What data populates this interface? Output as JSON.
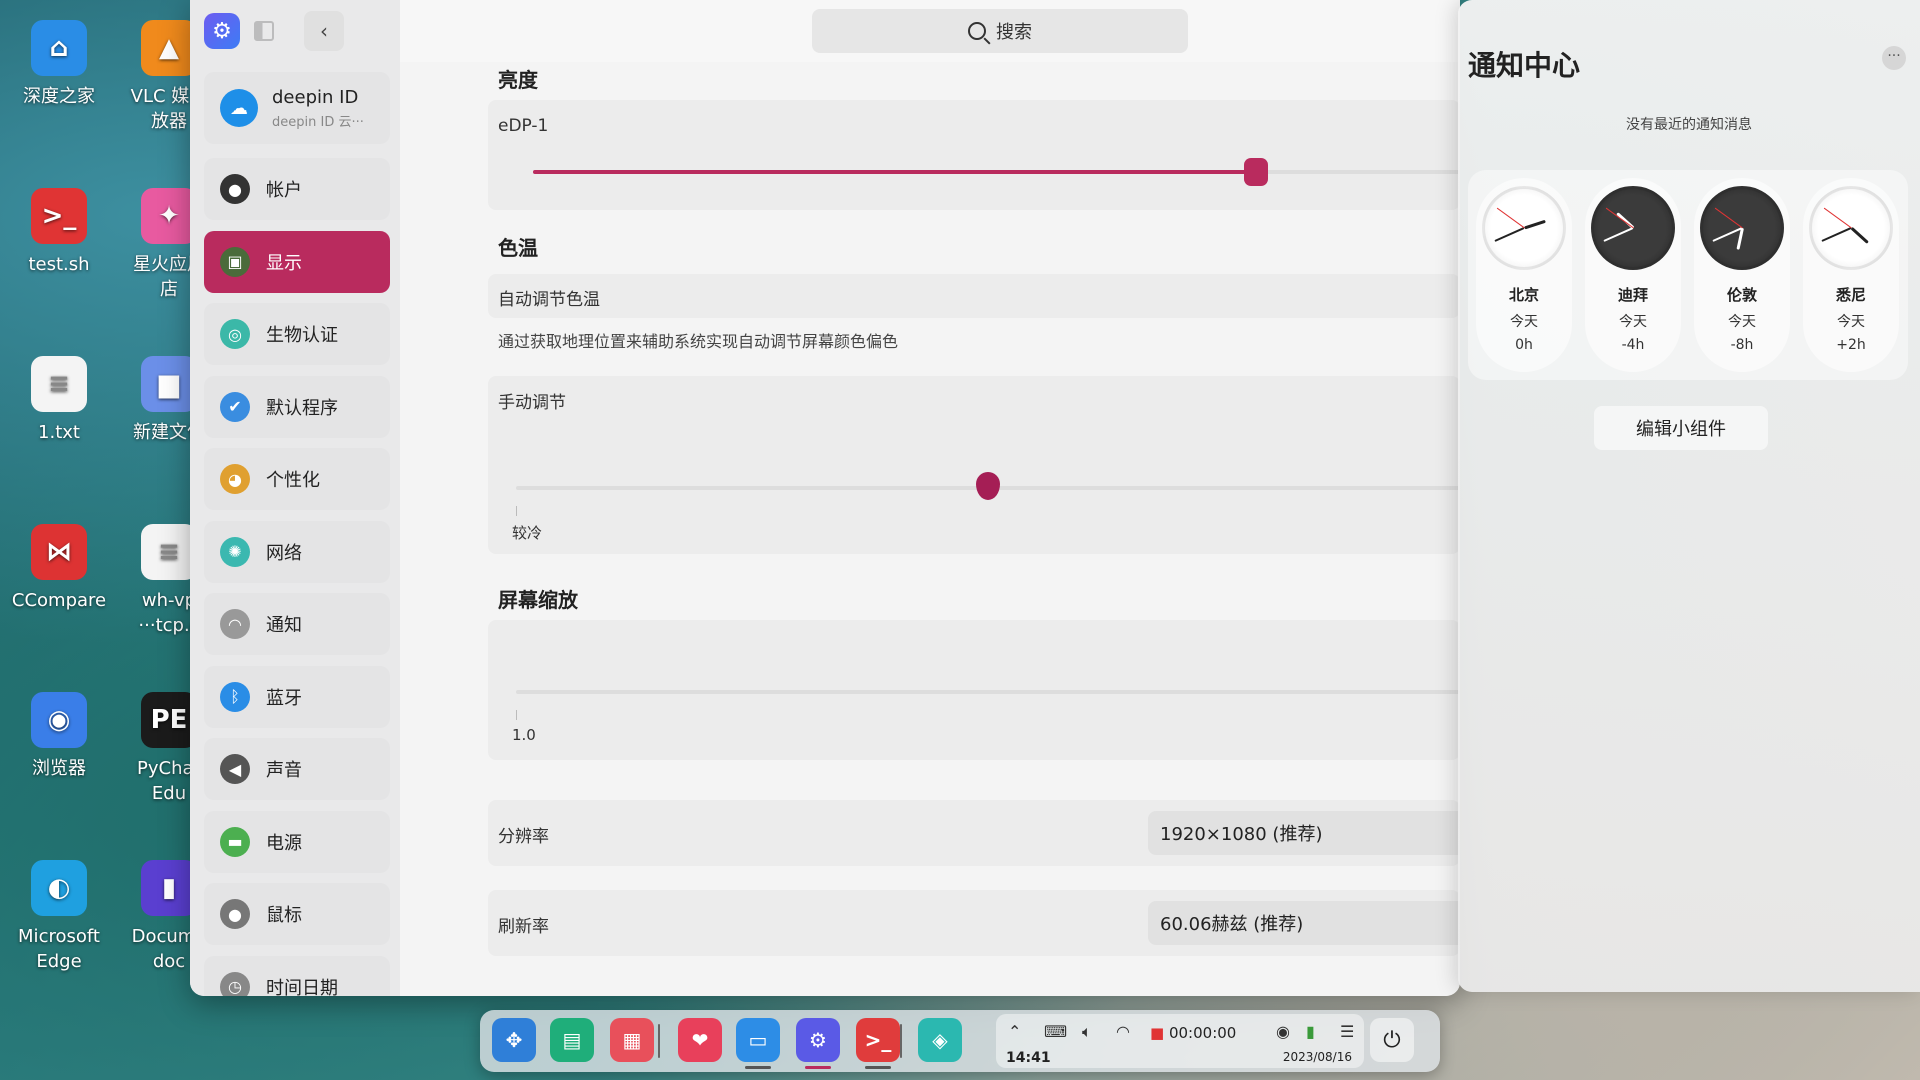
{
  "desktop": {
    "icons": [
      {
        "label": "深度之家",
        "glyph": "⌂",
        "color": "#2a8de6"
      },
      {
        "label": "VLC 媒体\n放器",
        "glyph": "▲",
        "color": "#f08a1c"
      },
      {
        "label": "test.sh",
        "glyph": ">_",
        "color": "#e03434"
      },
      {
        "label": "星火应用\n店",
        "glyph": "✦",
        "color": "#e85aa0"
      },
      {
        "label": "1.txt",
        "glyph": "≡",
        "color": "#f4f4f4"
      },
      {
        "label": "新建文件",
        "glyph": "▆",
        "color": "#6b8fe8"
      },
      {
        "label": "CCompare",
        "glyph": "⋈",
        "color": "#d33"
      },
      {
        "label": "wh-vp\n···tcp.c",
        "glyph": "≡",
        "color": "#f4f4f4"
      },
      {
        "label": "浏览器",
        "glyph": "◉",
        "color": "#3a7ee8"
      },
      {
        "label": "PyChar\nEdu",
        "glyph": "PE",
        "color": "#1b1b1b"
      },
      {
        "label": "Microsoft\nEdge",
        "glyph": "◐",
        "color": "#1fa0e0"
      },
      {
        "label": "Docume\ndoc",
        "glyph": "▮",
        "color": "#5a3fd0"
      }
    ]
  },
  "sidebar": {
    "deepin_id": {
      "name": "deepin ID",
      "sub": "deepin ID 云···"
    },
    "items": [
      {
        "label": "帐户",
        "icon": "user-icon",
        "glyph": "●",
        "color": "#333"
      },
      {
        "label": "显示",
        "icon": "display-icon",
        "glyph": "▣",
        "color": "#4a6b3a"
      },
      {
        "label": "生物认证",
        "icon": "biometric-icon",
        "glyph": "◎",
        "color": "#3bb8a8"
      },
      {
        "label": "默认程序",
        "icon": "default-apps-icon",
        "glyph": "✔",
        "color": "#3a8de0"
      },
      {
        "label": "个性化",
        "icon": "personalization-icon",
        "glyph": "◕",
        "color": "#e0a030"
      },
      {
        "label": "网络",
        "icon": "network-icon",
        "glyph": "✺",
        "color": "#3bb8b0"
      },
      {
        "label": "通知",
        "icon": "bell-icon",
        "glyph": "◠",
        "color": "#999"
      },
      {
        "label": "蓝牙",
        "icon": "bluetooth-icon",
        "glyph": "ᛒ",
        "color": "#2a8de6"
      },
      {
        "label": "声音",
        "icon": "speaker-icon",
        "glyph": "◀",
        "color": "#555"
      },
      {
        "label": "电源",
        "icon": "battery-icon",
        "glyph": "▬",
        "color": "#4caf50"
      },
      {
        "label": "鼠标",
        "icon": "mouse-icon",
        "glyph": "●",
        "color": "#777"
      },
      {
        "label": "时间日期",
        "icon": "clock-icon",
        "glyph": "◷",
        "color": "#888"
      }
    ],
    "active_index": 1
  },
  "search": {
    "placeholder": "搜索"
  },
  "display": {
    "brightness": {
      "title": "亮度",
      "monitor": "eDP-1",
      "value": 0.78
    },
    "color_temp": {
      "title": "色温",
      "auto_label": "自动调节色温",
      "auto_desc": "通过获取地理位置来辅助系统实现自动调节屏幕颜色偏色",
      "manual_label": "手动调节",
      "min_label": "较冷",
      "value": 0.5
    },
    "scaling": {
      "title": "屏幕缩放",
      "min_label": "1.0"
    },
    "resolution": {
      "label": "分辨率",
      "value": "1920×1080 (推荐)"
    },
    "refresh": {
      "label": "刷新率",
      "value": "60.06赫兹 (推荐)"
    }
  },
  "notification_center": {
    "title": "通知中心",
    "more": "···",
    "empty_text": "没有最近的通知消息",
    "clocks": [
      {
        "city": "北京",
        "day": "今天",
        "offset": "0h",
        "theme": "light",
        "hour_deg": 72,
        "min_deg": 246
      },
      {
        "city": "迪拜",
        "day": "今天",
        "offset": "-4h",
        "theme": "dark",
        "hour_deg": 312,
        "min_deg": 246
      },
      {
        "city": "伦敦",
        "day": "今天",
        "offset": "-8h",
        "theme": "dark",
        "hour_deg": 192,
        "min_deg": 246
      },
      {
        "city": "悉尼",
        "day": "今天",
        "offset": "+2h",
        "theme": "light",
        "hour_deg": 132,
        "min_deg": 246
      }
    ],
    "edit_widget": "编辑小组件"
  },
  "dock": {
    "apps": [
      {
        "name": "launcher-icon",
        "glyph": "✥",
        "color": "#2f7fd8"
      },
      {
        "name": "multitask-icon",
        "glyph": "▤",
        "color": "#1fae7a"
      },
      {
        "name": "app-store-icon",
        "glyph": "▦",
        "color": "#e8505b"
      },
      {
        "name": "spark-store-icon",
        "glyph": "❤",
        "color": "#e8405b"
      },
      {
        "name": "file-manager-icon",
        "glyph": "▭",
        "color": "#2d8de6"
      },
      {
        "name": "control-center-icon",
        "glyph": "⚙",
        "color": "#5a5ae6"
      },
      {
        "name": "terminal-icon",
        "glyph": ">_",
        "color": "#e03c3c"
      },
      {
        "name": "screenshot-icon",
        "glyph": "◈",
        "color": "#2bb8b0"
      }
    ],
    "tray": {
      "recording": "00:00:00",
      "time": "14:41",
      "date": "2023/08/16"
    },
    "power": "⏻"
  }
}
